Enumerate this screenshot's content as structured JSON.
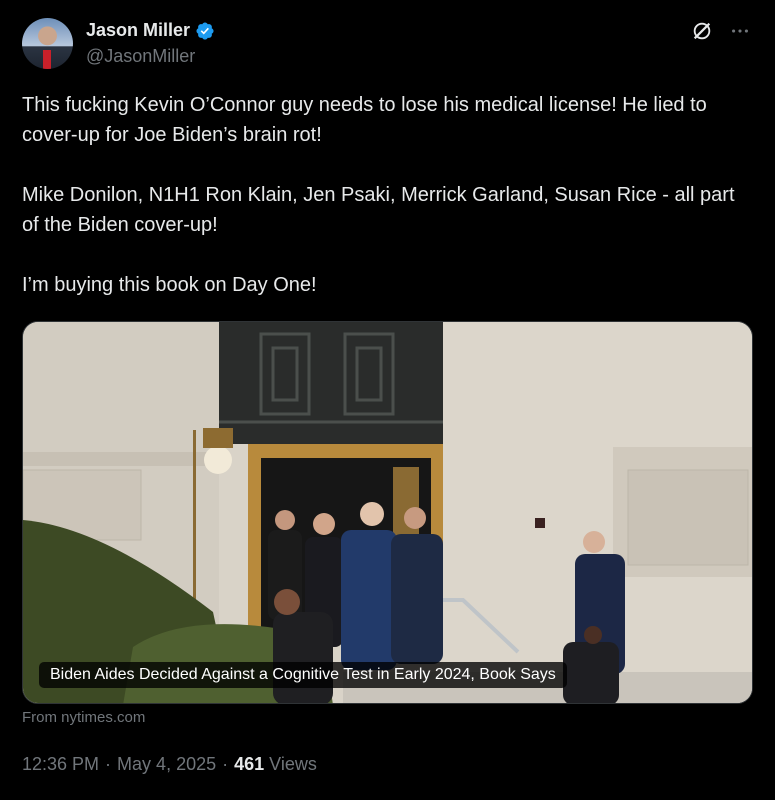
{
  "author": {
    "name": "Jason Miller",
    "handle": "@JasonMiller"
  },
  "tweet": {
    "paragraphs": [
      "This fucking Kevin O’Connor guy needs to lose his medical license! He lied to cover-up for Joe Biden’s brain rot!",
      "Mike Donilon, N1H1 Ron Klain, Jen Psaki, Merrick Garland, Susan Rice - all part of the Biden cover-up!",
      "I’m buying this book on Day One!"
    ]
  },
  "card": {
    "caption": "Biden Aides Decided Against a Cognitive Test in Early 2024, Book Says",
    "source": "From nytimes.com"
  },
  "meta": {
    "time": "12:36 PM",
    "separator": "·",
    "date": "May 4, 2025",
    "views_count": "461",
    "views_label": "Views"
  },
  "colors": {
    "background": "#000000",
    "text": "#e7e9ea",
    "secondary": "#71767b",
    "verified": "#1d9bf0"
  }
}
